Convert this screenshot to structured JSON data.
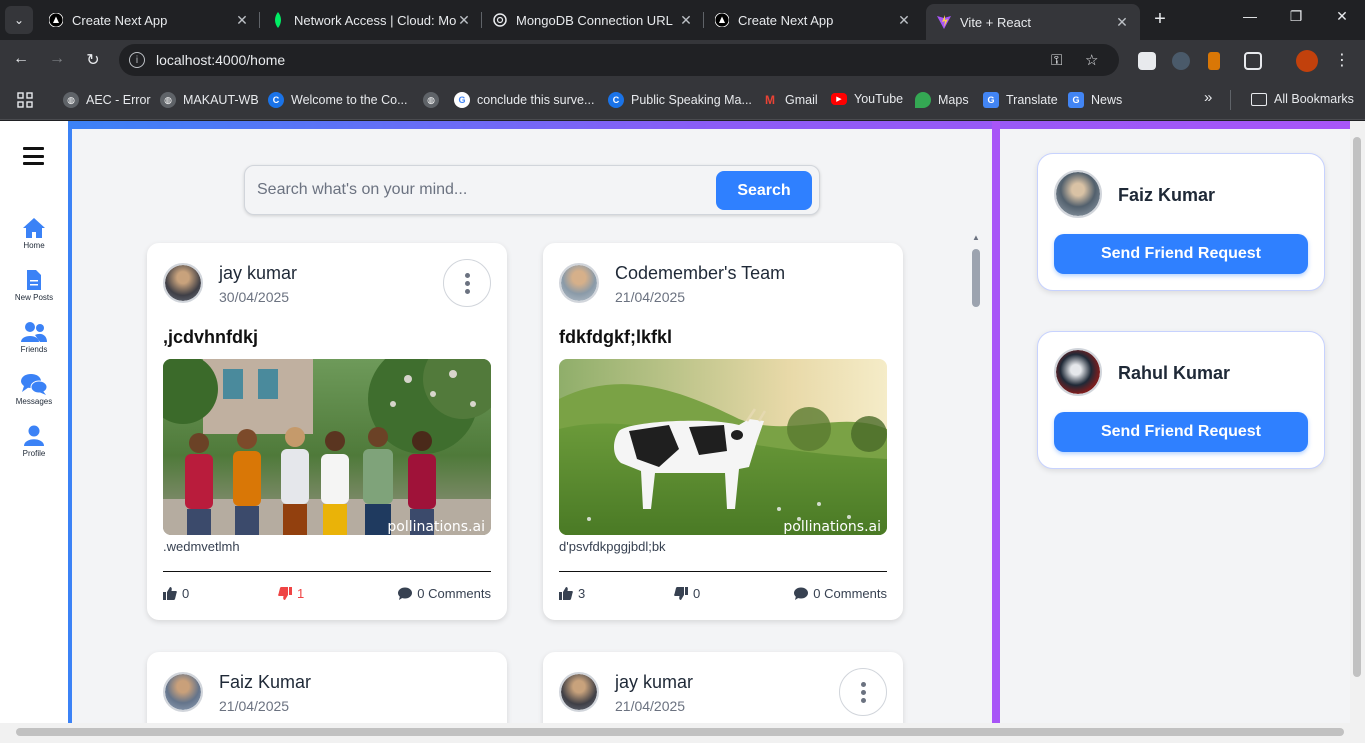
{
  "browser": {
    "tabs": [
      {
        "title": "Create Next App",
        "favicon": "nextjs-icon"
      },
      {
        "title": "Network Access | Cloud: Mo",
        "favicon": "mongodb-icon"
      },
      {
        "title": "MongoDB Connection URL",
        "favicon": "openai-icon"
      },
      {
        "title": "Create Next App",
        "favicon": "nextjs-icon"
      },
      {
        "title": "Vite + React",
        "favicon": "vite-icon",
        "active": true
      }
    ],
    "url": "localhost:4000/home",
    "bookmarks": [
      {
        "label": "AEC - Error"
      },
      {
        "label": "MAKAUT-WB"
      },
      {
        "label": "Welcome to the Co..."
      },
      {
        "label": ""
      },
      {
        "label": "conclude this surve..."
      },
      {
        "label": "Public Speaking Ma..."
      },
      {
        "label": "Gmail"
      },
      {
        "label": "YouTube"
      },
      {
        "label": "Maps"
      },
      {
        "label": "Translate"
      },
      {
        "label": "News"
      }
    ],
    "all_bookmarks": "All Bookmarks",
    "more_bookmarks": "»"
  },
  "sidebar": {
    "items": [
      {
        "label": "Home",
        "icon": "home-icon"
      },
      {
        "label": "New Posts",
        "icon": "document-icon"
      },
      {
        "label": "Friends",
        "icon": "users-icon"
      },
      {
        "label": "Messages",
        "icon": "chat-icon"
      },
      {
        "label": "Profile",
        "icon": "user-icon"
      }
    ]
  },
  "search": {
    "placeholder": "Search what's on your mind...",
    "button": "Search"
  },
  "posts": [
    {
      "author": "jay kumar",
      "date": "30/04/2025",
      "title": ",jcdvhnfdkj",
      "description": ".wedmvetlmh",
      "likes": "0",
      "dislikes": "1",
      "comments": "0 Comments",
      "watermark": "pollinations.ai",
      "has_menu": true,
      "image": "group-of-students"
    },
    {
      "author": "Codemember's Team",
      "date": "21/04/2025",
      "title": "fdkfdgkf;lkfkl",
      "description": "d'psvfdkpggjbdl;bk",
      "likes": "3",
      "dislikes": "0",
      "comments": "0 Comments",
      "watermark": "pollinations.ai",
      "has_menu": false,
      "image": "cow-in-meadow"
    },
    {
      "author": "Faiz Kumar",
      "date": "21/04/2025",
      "has_menu": false
    },
    {
      "author": "jay kumar",
      "date": "21/04/2025",
      "has_menu": true
    }
  ],
  "friend_suggestions": [
    {
      "name": "Faiz Kumar",
      "button": "Send Friend Request"
    },
    {
      "name": "Rahul Kumar",
      "button": "Send Friend Request"
    }
  ],
  "colors": {
    "accent": "#2f80ff",
    "gradient_start": "#3b82f6",
    "gradient_end": "#a855f7",
    "dislike_active": "#ef4444"
  }
}
